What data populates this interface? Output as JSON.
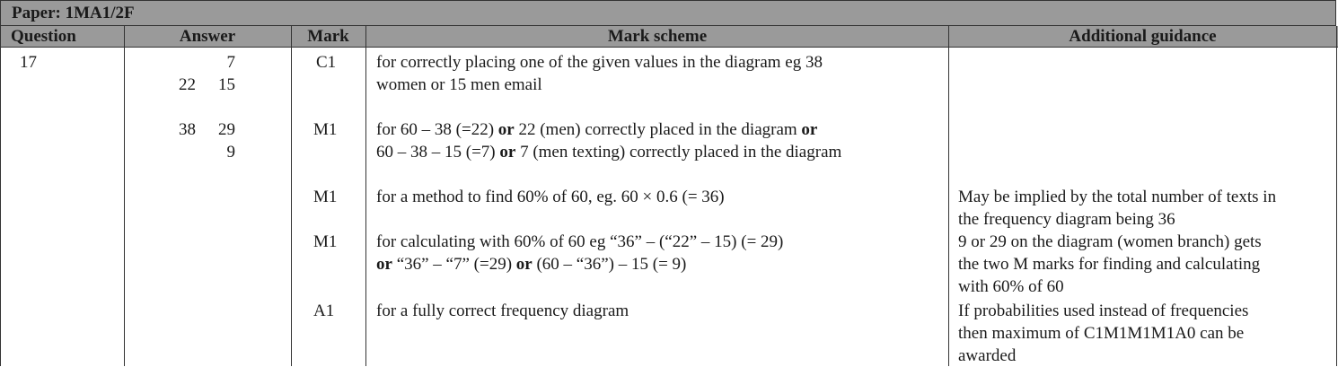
{
  "paper": {
    "label": "Paper: 1MA1/2F"
  },
  "headers": {
    "question": "Question",
    "answer": "Answer",
    "mark": "Mark",
    "scheme": "Mark scheme",
    "guidance": "Additional guidance"
  },
  "question_number": "17",
  "answer": {
    "r1_right": "7",
    "r2_left": "22",
    "r2_right": "15",
    "r3_left": "38",
    "r3_right": "29",
    "r4_right": "9"
  },
  "rows": [
    {
      "mark": "C1",
      "scheme_lines": [
        [
          {
            "t": "for correctly placing one of the given values in the diagram eg  38"
          }
        ],
        [
          {
            "t": "women or 15 men email"
          }
        ]
      ],
      "guidance_lines": []
    },
    {
      "mark": "M1",
      "scheme_lines": [
        [
          {
            "t": "for 60 – 38 (=22) "
          },
          {
            "t": "or",
            "b": true
          },
          {
            "t": "  22 (men) correctly placed in the diagram "
          },
          {
            "t": "or",
            "b": true
          }
        ],
        [
          {
            "t": "60 – 38 – 15 (=7) "
          },
          {
            "t": "or",
            "b": true
          },
          {
            "t": "  7 (men texting) correctly placed in the diagram"
          }
        ]
      ],
      "guidance_lines": []
    },
    {
      "mark": "M1",
      "scheme_lines": [
        [
          {
            "t": "for a method to find 60% of 60, eg. 60 × 0.6 (= 36)"
          }
        ]
      ],
      "guidance_lines": [
        "May be implied by the total number of texts in",
        "the frequency diagram being 36"
      ]
    },
    {
      "mark": "M1",
      "scheme_lines": [
        [
          {
            "t": "for calculating with 60% of 60 eg “36” – (“22” – 15)  (= 29)"
          }
        ],
        [
          {
            "t": "or",
            "b": true
          },
          {
            "t": " “36” – “7” (=29) "
          },
          {
            "t": "or",
            "b": true
          },
          {
            "t": " (60 – “36”) – 15  (= 9)"
          }
        ]
      ],
      "guidance_lines": [
        "9 or 29 on the diagram (women branch) gets",
        "the two M marks for finding and calculating",
        "with 60% of 60"
      ]
    },
    {
      "mark": "A1",
      "scheme_lines": [
        [
          {
            "t": "for a fully correct frequency diagram"
          }
        ]
      ],
      "guidance_lines": [
        "If probabilities used instead of frequencies",
        "then  maximum of C1M1M1M1A0 can be",
        "awarded"
      ]
    }
  ]
}
